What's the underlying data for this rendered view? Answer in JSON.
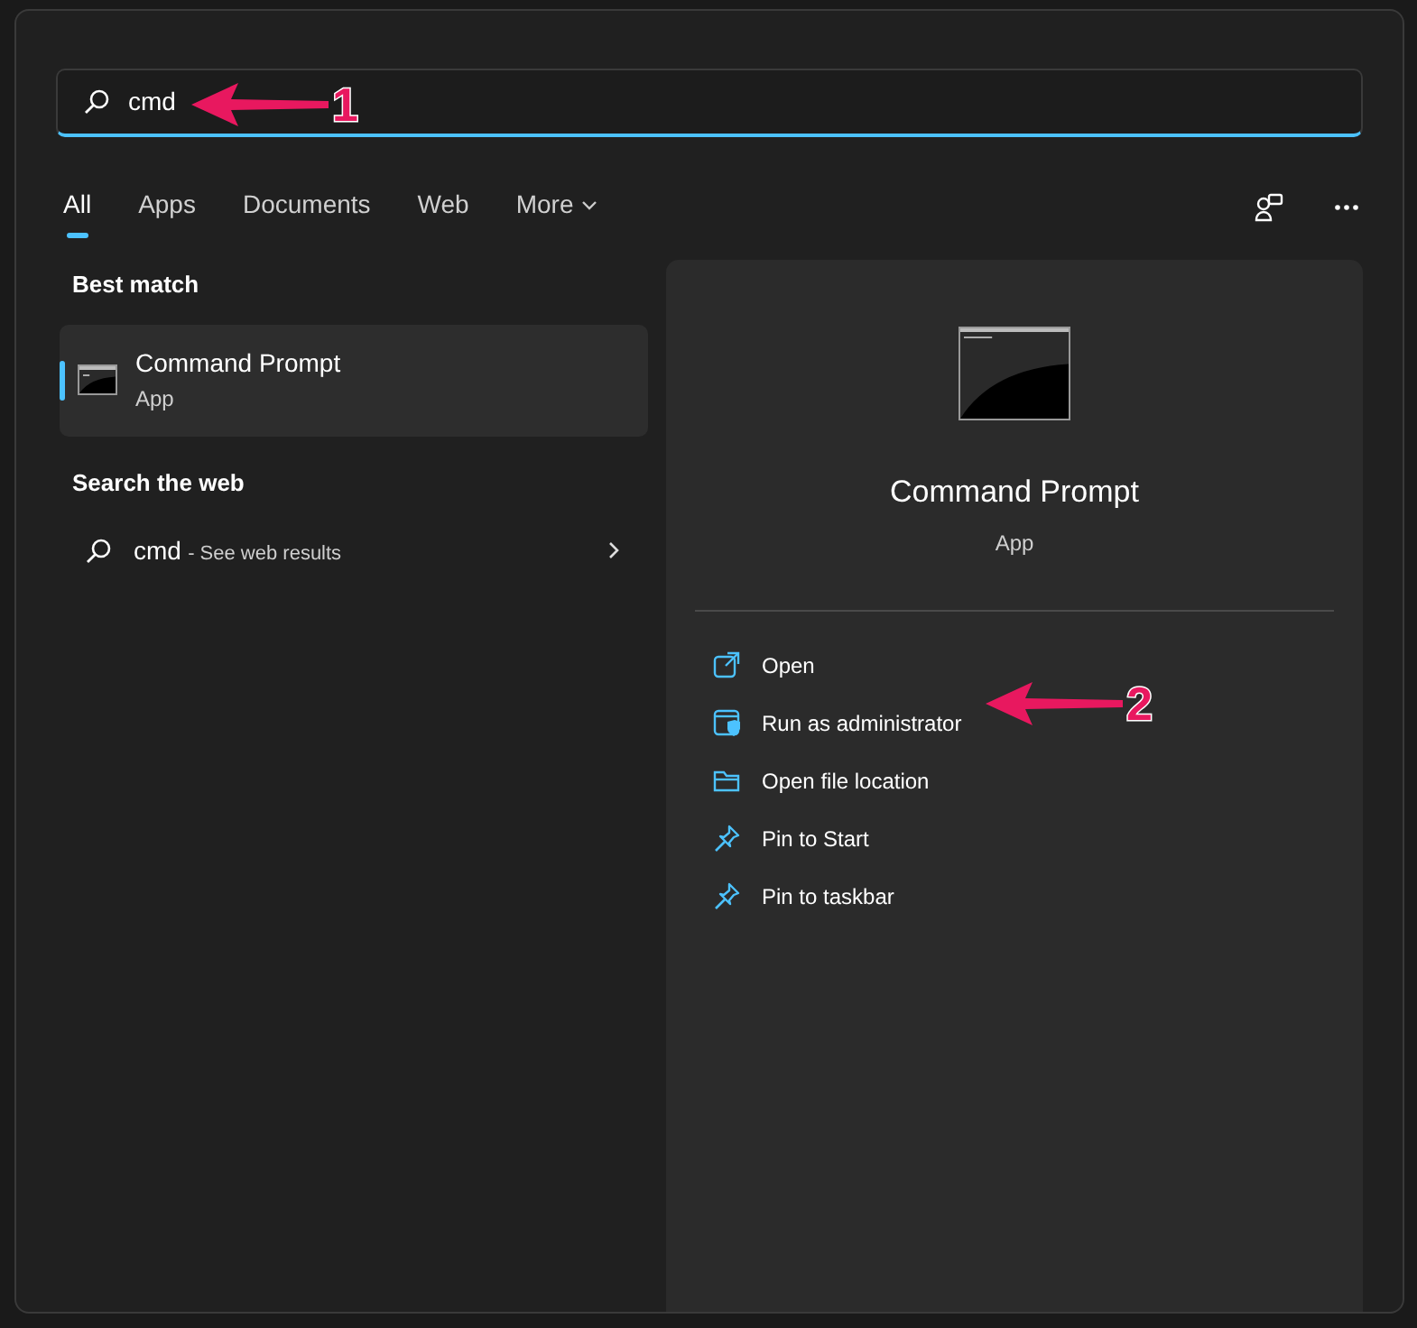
{
  "search": {
    "value": "cmd"
  },
  "tabs": [
    {
      "label": "All",
      "selected": true,
      "kind": "tab"
    },
    {
      "label": "Apps",
      "selected": false,
      "kind": "tab"
    },
    {
      "label": "Documents",
      "selected": false,
      "kind": "tab"
    },
    {
      "label": "Web",
      "selected": false,
      "kind": "tab"
    },
    {
      "label": "More",
      "selected": false,
      "kind": "dropdown"
    }
  ],
  "best_match": {
    "heading": "Best match",
    "item": {
      "title": "Command Prompt",
      "subtitle": "App",
      "selected": true
    }
  },
  "web": {
    "heading": "Search the web",
    "query": "cmd",
    "suffix": "- See web results"
  },
  "preview": {
    "title": "Command Prompt",
    "subtitle": "App",
    "actions": [
      {
        "label": "Open",
        "kind": "open"
      },
      {
        "label": "Run as administrator",
        "kind": "admin"
      },
      {
        "label": "Open file location",
        "kind": "folder"
      },
      {
        "label": "Pin to Start",
        "kind": "pin"
      },
      {
        "label": "Pin to taskbar",
        "kind": "pin"
      }
    ]
  },
  "annotations": [
    {
      "label": "1"
    },
    {
      "label": "2"
    }
  ]
}
